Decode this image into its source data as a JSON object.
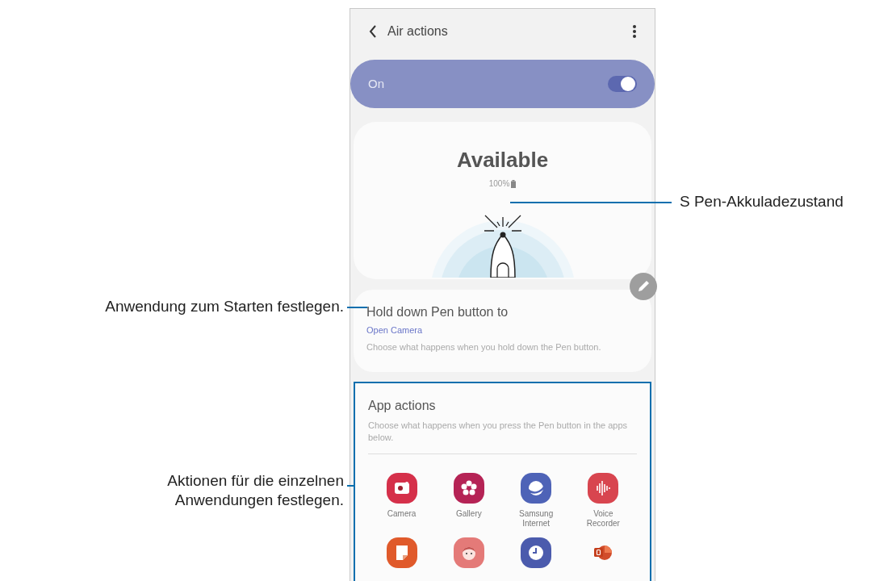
{
  "phone": {
    "title": "Air actions",
    "master_switch": {
      "label": "On",
      "on": true
    },
    "status": {
      "title": "Available",
      "battery": "100%"
    },
    "hold_setting": {
      "title": "Hold down Pen button to",
      "value": "Open Camera",
      "description": "Choose what happens when you hold down the Pen button."
    },
    "app_actions": {
      "title": "App actions",
      "description": "Choose what happens when you press the Pen button in the apps below.",
      "apps": [
        {
          "kind": "camera",
          "label": "Camera"
        },
        {
          "kind": "gallery",
          "label": "Gallery"
        },
        {
          "kind": "internet",
          "label": "Samsung Internet"
        },
        {
          "kind": "recorder",
          "label": "Voice Recorder"
        },
        {
          "kind": "notes"
        },
        {
          "kind": "face"
        },
        {
          "kind": "clock"
        },
        {
          "kind": "slides"
        }
      ]
    }
  },
  "callouts": [
    {
      "kind": "right",
      "lines": [
        "S Pen-Akkuladezustand"
      ]
    },
    {
      "kind": "left",
      "lines": [
        "Anwendung zum Starten festlegen."
      ]
    },
    {
      "kind": "left",
      "lines": [
        "Aktionen für die einzelnen",
        "Anwendungen festlegen."
      ]
    }
  ]
}
